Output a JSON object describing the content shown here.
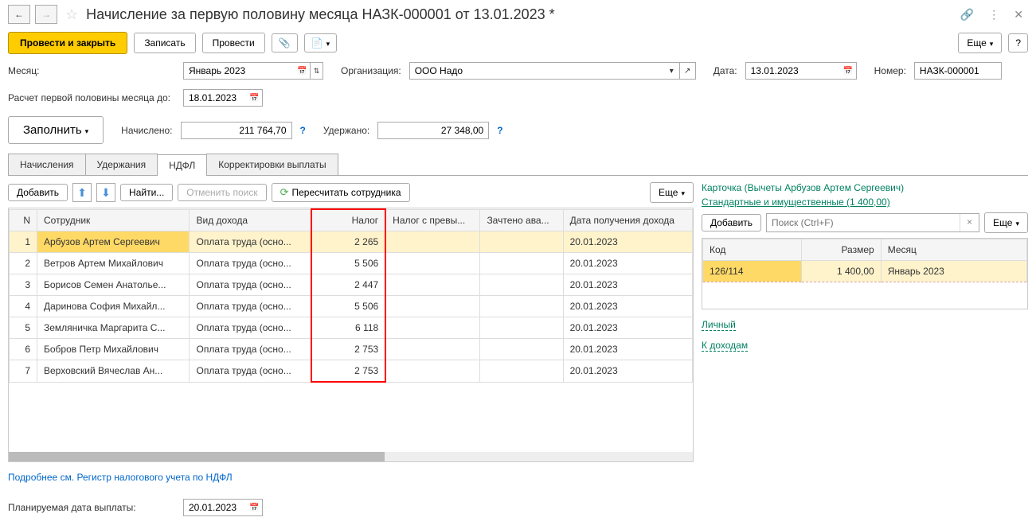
{
  "header": {
    "title": "Начисление за первую половину месяца НАЗК-000001 от 13.01.2023 *"
  },
  "toolbar": {
    "submit_close": "Провести и закрыть",
    "save": "Записать",
    "submit": "Провести",
    "more": "Еще",
    "help": "?"
  },
  "form": {
    "month_label": "Месяц:",
    "month_value": "Январь 2023",
    "org_label": "Организация:",
    "org_value": "ООО Надо",
    "date_label": "Дата:",
    "date_value": "13.01.2023",
    "number_label": "Номер:",
    "number_value": "НАЗК-000001",
    "calc_until_label": "Расчет первой половины месяца до:",
    "calc_until_value": "18.01.2023",
    "fill": "Заполнить",
    "accrued_label": "Начислено:",
    "accrued_value": "211 764,70",
    "withheld_label": "Удержано:",
    "withheld_value": "27 348,00"
  },
  "tabs": {
    "t1": "Начисления",
    "t2": "Удержания",
    "t3": "НДФЛ",
    "t4": "Корректировки выплаты"
  },
  "panel": {
    "add": "Добавить",
    "find": "Найти...",
    "cancel_search": "Отменить поиск",
    "recalc": "Пересчитать сотрудника",
    "more": "Еще"
  },
  "table": {
    "headers": {
      "n": "N",
      "emp": "Сотрудник",
      "type": "Вид дохода",
      "tax": "Налог",
      "exc": "Налог с превы...",
      "adv": "Зачтено ава...",
      "date": "Дата получения дохода"
    },
    "rows": [
      {
        "n": "1",
        "emp": "Арбузов Артем Сергеевич",
        "type": "Оплата труда (осно...",
        "tax": "2 265",
        "date": "20.01.2023"
      },
      {
        "n": "2",
        "emp": "Ветров Артем Михайлович",
        "type": "Оплата труда (осно...",
        "tax": "5 506",
        "date": "20.01.2023"
      },
      {
        "n": "3",
        "emp": "Борисов Семен Анатолье...",
        "type": "Оплата труда (осно...",
        "tax": "2 447",
        "date": "20.01.2023"
      },
      {
        "n": "4",
        "emp": "Даринова София Михайл...",
        "type": "Оплата труда (осно...",
        "tax": "5 506",
        "date": "20.01.2023"
      },
      {
        "n": "5",
        "emp": "Земляничка Маргарита С...",
        "type": "Оплата труда (осно...",
        "tax": "6 118",
        "date": "20.01.2023"
      },
      {
        "n": "6",
        "emp": "Бобров Петр Михайлович",
        "type": "Оплата труда (осно...",
        "tax": "2 753",
        "date": "20.01.2023"
      },
      {
        "n": "7",
        "emp": "Верховский Вячеслав Ан...",
        "type": "Оплата труда (осно...",
        "tax": "2 753",
        "date": "20.01.2023"
      }
    ]
  },
  "right": {
    "card_label": "Карточка (Вычеты Арбузов Артем Сергеевич)",
    "std_link": "Стандартные и имущественные (1 400,00)",
    "add": "Добавить",
    "search_placeholder": "Поиск (Ctrl+F)",
    "more": "Еще",
    "headers": {
      "code": "Код",
      "size": "Размер",
      "month": "Месяц"
    },
    "row": {
      "code": "126/114",
      "size": "1 400,00",
      "month": "Январь 2023"
    },
    "personal": "Личный",
    "to_income": "К доходам"
  },
  "footer": {
    "tax_link": "Подробнее см. Регистр налогового учета по НДФЛ",
    "plan_date_label": "Планируемая дата выплаты:",
    "plan_date_value": "20.01.2023"
  }
}
